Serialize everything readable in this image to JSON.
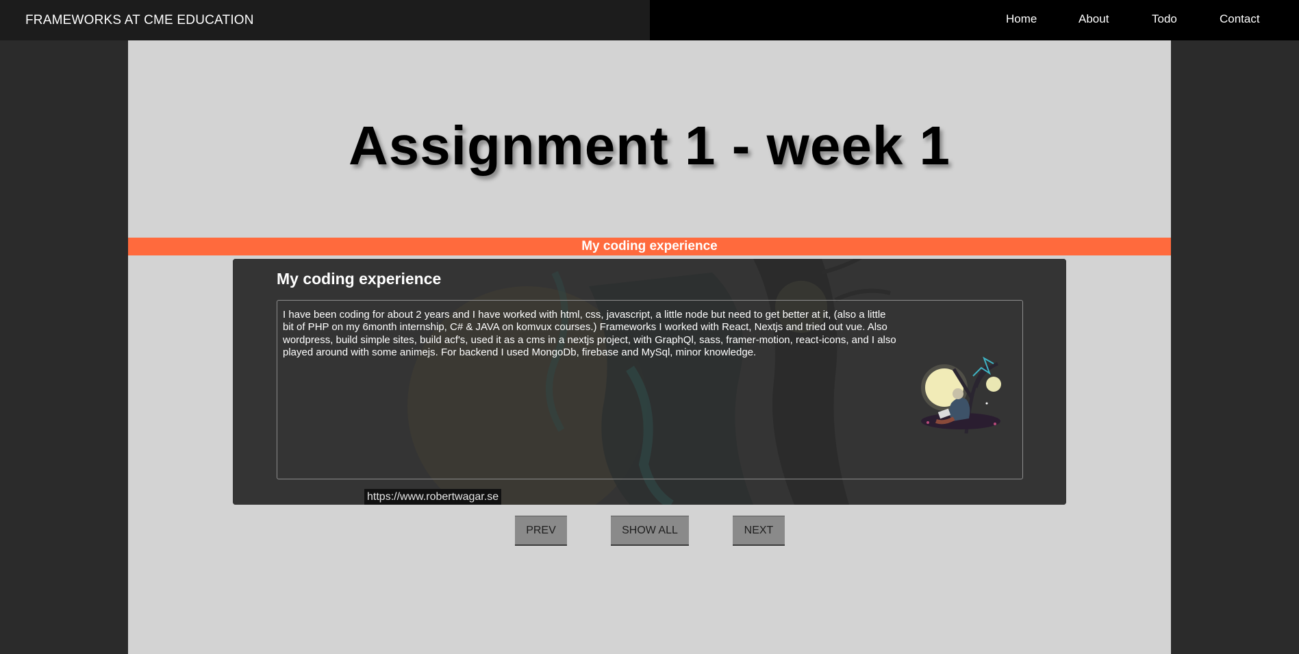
{
  "header": {
    "brand": "FRAMEWORKS AT CME EDUCATION",
    "nav": [
      {
        "label": "Home"
      },
      {
        "label": "About"
      },
      {
        "label": "Todo"
      },
      {
        "label": "Contact"
      }
    ]
  },
  "page": {
    "title": "Assignment 1 - week 1",
    "banner": "My coding experience"
  },
  "card": {
    "title": "My coding experience",
    "body": "I have been coding for about 2 years and I have worked with html, css, javascript, a little node but need to get better at it, (also a little bit of PHP on my 6month internship, C# & JAVA on komvux courses.) Frameworks I worked with React, Nextjs and tried out vue. Also wordpress, build simple sites, build acf's, used it as a cms in a nextjs project, with GraphQl, sass, framer-motion, react-icons, and I also played around with some animejs. For backend I used MongoDb, firebase and MySql, minor knowledge.",
    "url": "https://www.robertwagar.se"
  },
  "controls": {
    "prev_label": "PREV",
    "show_all_label": "SHOW ALL",
    "next_label": "NEXT"
  },
  "colors": {
    "banner": "#ff6a3d",
    "page_bg": "#2b2b2b",
    "content_bg": "#d3d3d3",
    "card_bg": "#333333",
    "button_bg": "#8a8a8a"
  }
}
